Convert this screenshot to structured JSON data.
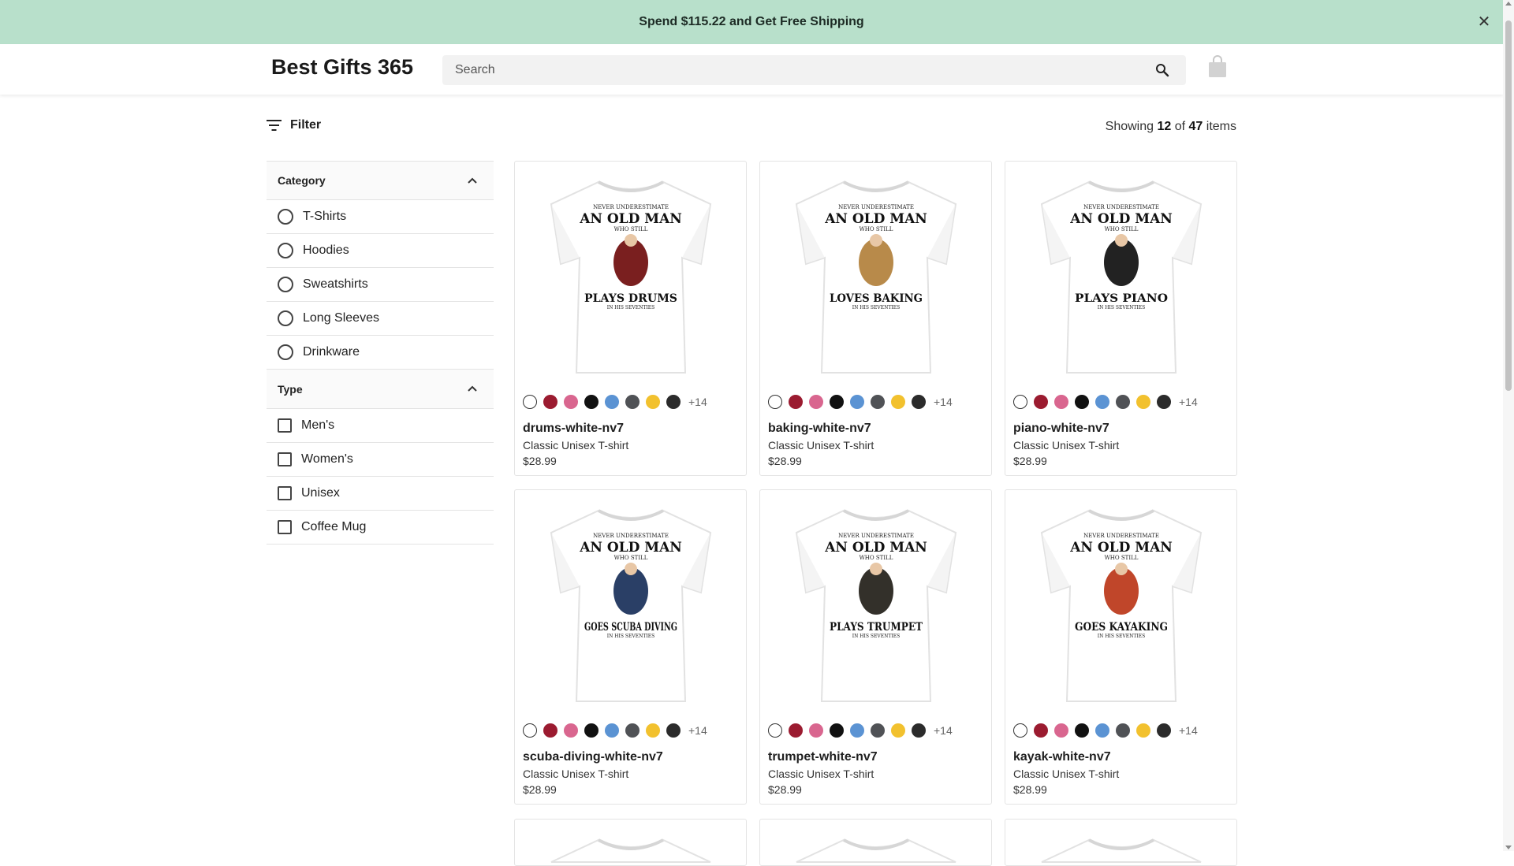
{
  "banner": {
    "text": "Spend $115.22 and Get Free Shipping",
    "close": "✕"
  },
  "header": {
    "logo": "Best Gifts 365",
    "search_placeholder": "Search"
  },
  "toolbar": {
    "filter_label": "Filter",
    "showing_prefix": "Showing",
    "shown": "12",
    "of": "of",
    "total": "47",
    "items": "items"
  },
  "sidebar": {
    "category": {
      "title": "Category",
      "options": [
        "T-Shirts",
        "Hoodies",
        "Sweatshirts",
        "Long Sleeves",
        "Drinkware"
      ]
    },
    "type": {
      "title": "Type",
      "options": [
        "Men's",
        "Women's",
        "Unisex",
        "Coffee Mug"
      ]
    }
  },
  "colors": {
    "banner_bg": "#b8e0cb",
    "swatches": [
      "#ffffff",
      "#9b1b30",
      "#d9668f",
      "#111111",
      "#5b93d3",
      "#505256",
      "#f2c12e",
      "#2b2b2b"
    ]
  },
  "products": [
    {
      "title": "drums-white-nv7",
      "subtitle": "Classic Unisex T-shirt",
      "price": "$28.99",
      "more_colors": "+14",
      "print_top": "AN OLD MAN",
      "print_bottom": "PLAYS DRUMS",
      "art_color": "#7a1f1f"
    },
    {
      "title": "baking-white-nv7",
      "subtitle": "Classic Unisex T-shirt",
      "price": "$28.99",
      "more_colors": "+14",
      "print_top": "AN OLD MAN",
      "print_bottom": "LOVES BAKING",
      "art_color": "#b88a4a"
    },
    {
      "title": "piano-white-nv7",
      "subtitle": "Classic Unisex T-shirt",
      "price": "$28.99",
      "more_colors": "+14",
      "print_top": "AN OLD MAN",
      "print_bottom": "PLAYS PIANO",
      "art_color": "#222222"
    },
    {
      "title": "scuba-diving-white-nv7",
      "subtitle": "Classic Unisex T-shirt",
      "price": "$28.99",
      "more_colors": "+14",
      "print_top": "AN OLD MAN",
      "print_bottom": "GOES SCUBA DIVING",
      "art_color": "#2a3f66"
    },
    {
      "title": "trumpet-white-nv7",
      "subtitle": "Classic Unisex T-shirt",
      "price": "$28.99",
      "more_colors": "+14",
      "print_top": "AN OLD MAN",
      "print_bottom": "PLAYS TRUMPET",
      "art_color": "#33302a"
    },
    {
      "title": "kayak-white-nv7",
      "subtitle": "Classic Unisex T-shirt",
      "price": "$28.99",
      "more_colors": "+14",
      "print_top": "AN OLD MAN",
      "print_bottom": "GOES KAYAKING",
      "art_color": "#c0462a"
    }
  ]
}
